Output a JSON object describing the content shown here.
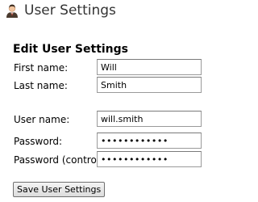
{
  "header": {
    "title": "User Settings",
    "icon": "user-icon"
  },
  "form": {
    "title": "Edit User Settings",
    "fields": {
      "first_name": {
        "label": "First name:",
        "value": "Will"
      },
      "last_name": {
        "label": "Last name:",
        "value": "Smith"
      },
      "user_name": {
        "label": "User name:",
        "value": "will.smith"
      },
      "password": {
        "label": "Password:",
        "value": "••••••••••••"
      },
      "password_control": {
        "label": "Password (control):",
        "value": "••••••••••••"
      }
    },
    "save_label": "Save User Settings"
  }
}
